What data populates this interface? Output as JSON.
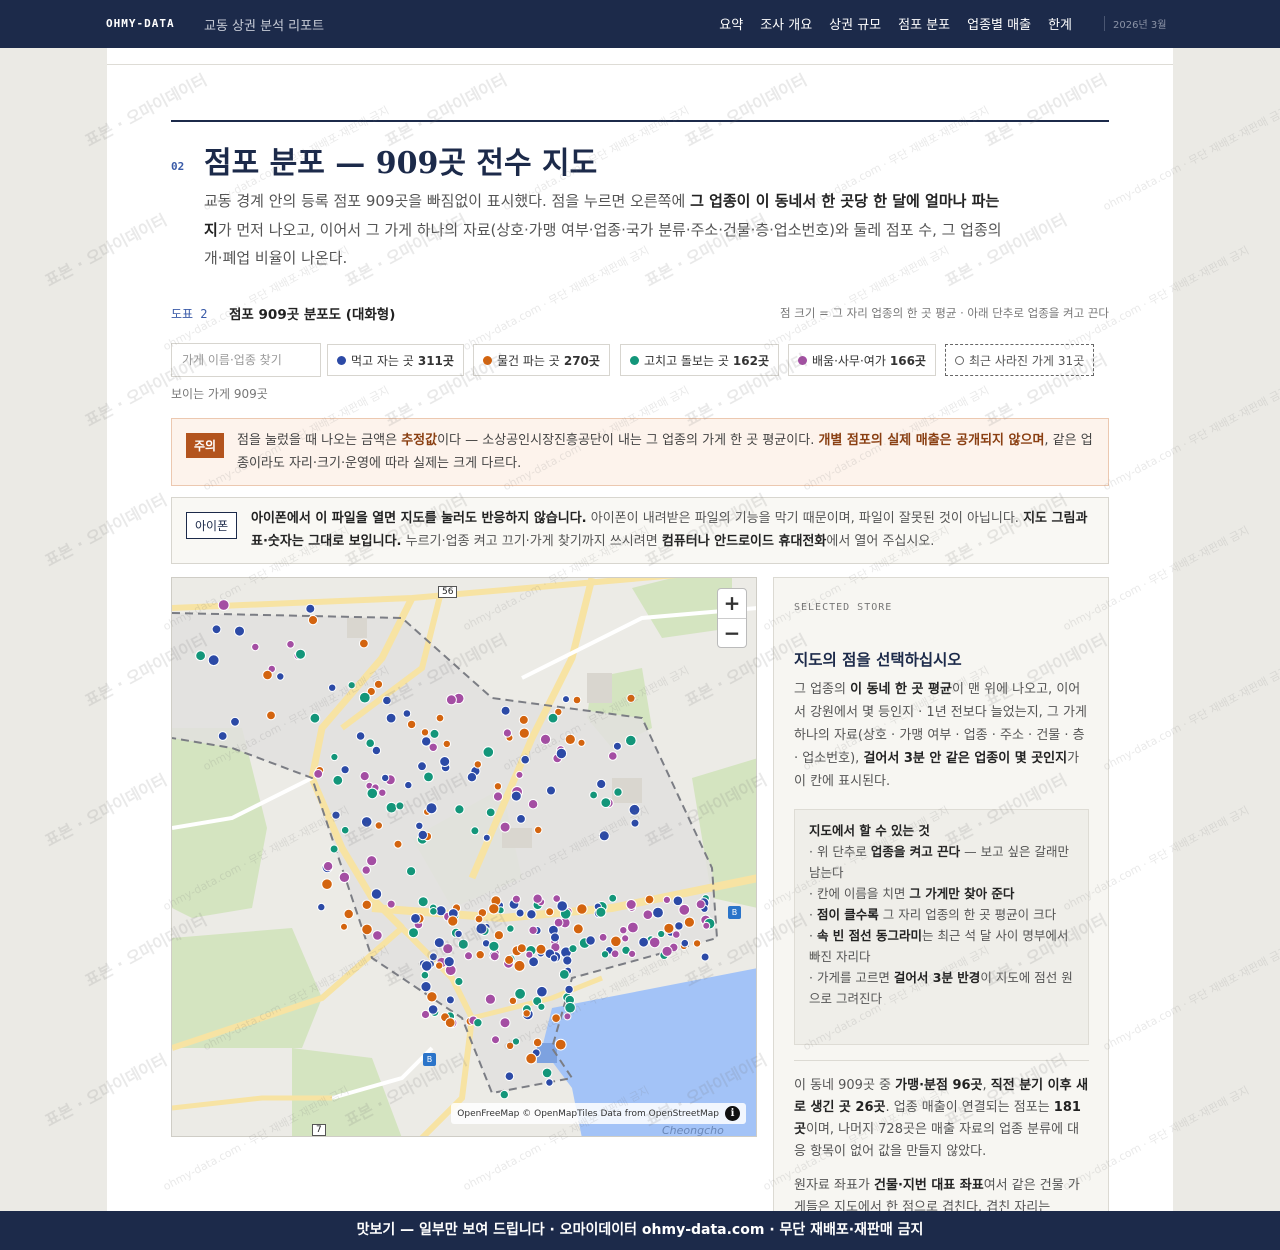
{
  "nav": {
    "brand": "OHMY-DATA",
    "subtitle": "교동 상권 분석 리포트",
    "links": [
      "요약",
      "조사 개요",
      "상권 규모",
      "점포 분포",
      "업종별 매출",
      "한계"
    ],
    "date": "2026년 3월"
  },
  "section": {
    "number": "02",
    "title": "점포 분포 — 909곳 전수 지도",
    "intro_1": "교동 경계 안의 등록 점포 909곳을 빠짐없이 표시했다. 점을 누르면 오른쪽에 ",
    "intro_bold": "그 업종이 이 동네서 한 곳당 한 달에 얼마나 파는지",
    "intro_2": "가 먼저 나오고, 이어서 그 가게 하나의 자료(상호·가맹 여부·업종·국가 분류·주소·건물·층·업소번호)와 둘레 점포 수, 그 업종의 개·폐업 비율이 나온다."
  },
  "figure": {
    "label": "도표 2",
    "title": "점포 909곳 분포도 (대화형)",
    "note": "점 크기 = 그 자리 업종의 한 곳 평균 · 아래 단추로 업종을 켜고 끈다"
  },
  "search": {
    "placeholder": "가게 이름·업종 찾기"
  },
  "filters": [
    {
      "label": "먹고 자는 곳",
      "count": "311곳",
      "color": "#2c4aa6"
    },
    {
      "label": "물건 파는 곳",
      "count": "270곳",
      "color": "#d3640f"
    },
    {
      "label": "고치고 돌보는 곳",
      "count": "162곳",
      "color": "#13967a"
    },
    {
      "label": "배움·사무·여가",
      "count": "166곳",
      "color": "#a44ea3"
    },
    {
      "label": "최근 사라진 가게",
      "count": "31곳",
      "color": "#666666"
    }
  ],
  "visible_count": "보이는 가게 909곳",
  "warning": {
    "tag": "주의",
    "t1": "점을 눌렀을 때 나오는 금액은 ",
    "b1": "추정값",
    "t2": "이다 — 소상공인시장진흥공단이 내는 그 업종의 가게 한 곳 평균이다. ",
    "b2": "개별 점포의 실제 매출은 공개되지 않으며",
    "t3": ", 같은 업종이라도 자리·크기·운영에 따라 실제는 크게 다르다."
  },
  "ios": {
    "tag": "아이폰",
    "b1": "아이폰에서 이 파일을 열면 지도를 눌러도 반응하지 않습니다.",
    "t1": " 아이폰이 내려받은 파일의 기능을 막기 때문이며, 파일이 잘못된 것이 아닙니다. ",
    "b2": "지도 그림과 표·숫자는 그대로 보입니다.",
    "t2": " 누르기·업종 켜고 끄기·가게 찾기까지 쓰시려면 ",
    "b3": "컴퓨터나 안드로이드 휴대전화",
    "t3": "에서 열어 주십시오."
  },
  "map": {
    "zoom_in": "+",
    "zoom_out": "−",
    "road_56": "56",
    "road_7": "7",
    "attribution": "OpenFreeMap © OpenMapTiles Data from OpenStreetMap",
    "info": "i",
    "place": "Cheongcho",
    "bus": "B"
  },
  "panel": {
    "kicker": "SELECTED STORE",
    "title": "지도의 점을 선택하십시오",
    "p1a": "그 업종의 ",
    "p1b": "이 동네 한 곳 평균",
    "p1c": "이 맨 위에 나오고, 이어서 강원에서 몇 등인지 · 1년 전보다 늘었는지, 그 가게 하나의 자료(상호 · 가맹 여부 · 업종 · 주소 · 건물 · 층 · 업소번호), ",
    "p1d": "걸어서 3분 안 같은 업종이 몇 곳인지",
    "p1e": "가 이 칸에 표시된다.",
    "howto_title": "지도에서 할 수 있는 것",
    "h1a": "· 위 단추로 ",
    "h1b": "업종을 켜고 끈다",
    "h1c": " — 보고 싶은 갈래만 남는다",
    "h2a": "· 칸에 이름을 치면 ",
    "h2b": "그 가게만 찾아 준다",
    "h3a": "· ",
    "h3b": "점이 클수록",
    "h3c": " 그 자리 업종의 한 곳 평균이 크다",
    "h4a": "· ",
    "h4b": "속 빈 점선 동그라미",
    "h4c": "는 최근 석 달 사이 명부에서 빠진 자리다",
    "h5a": "· 가게를 고르면 ",
    "h5b": "걸어서 3분 반경",
    "h5c": "이 지도에 점선 원으로 그려진다",
    "p2a": "이 동네 909곳 중 ",
    "p2b": "가맹·분점 96곳",
    "p2c": ", ",
    "p2d": "직전 분기 이후 새로 생긴 곳 26곳",
    "p2e": ". 업종 매출이 연결되는 점포는 ",
    "p2f": "181곳",
    "p2g": "이며, 나머지 728곳은 매출 자료의 업종 분류에 대응 항목이 없어 값을 만들지 않았다.",
    "p3a": "원자료 좌표가 ",
    "p3b": "건물·지번 대표 좌표",
    "p3c": "여서 같은 건물 가게들은 지도에서 한 점으로 겹친다. 겹친 자리는"
  },
  "watermark": {
    "main": "표본 · 오마이데이터",
    "small": "ohmy-data.com · 무단 재배포·재판매 금지"
  },
  "footer": "맛보기 — 일부만 보여 드립니다 · 오마이데이터 ohmy-data.com · 무단 재배포·재판매 금지"
}
